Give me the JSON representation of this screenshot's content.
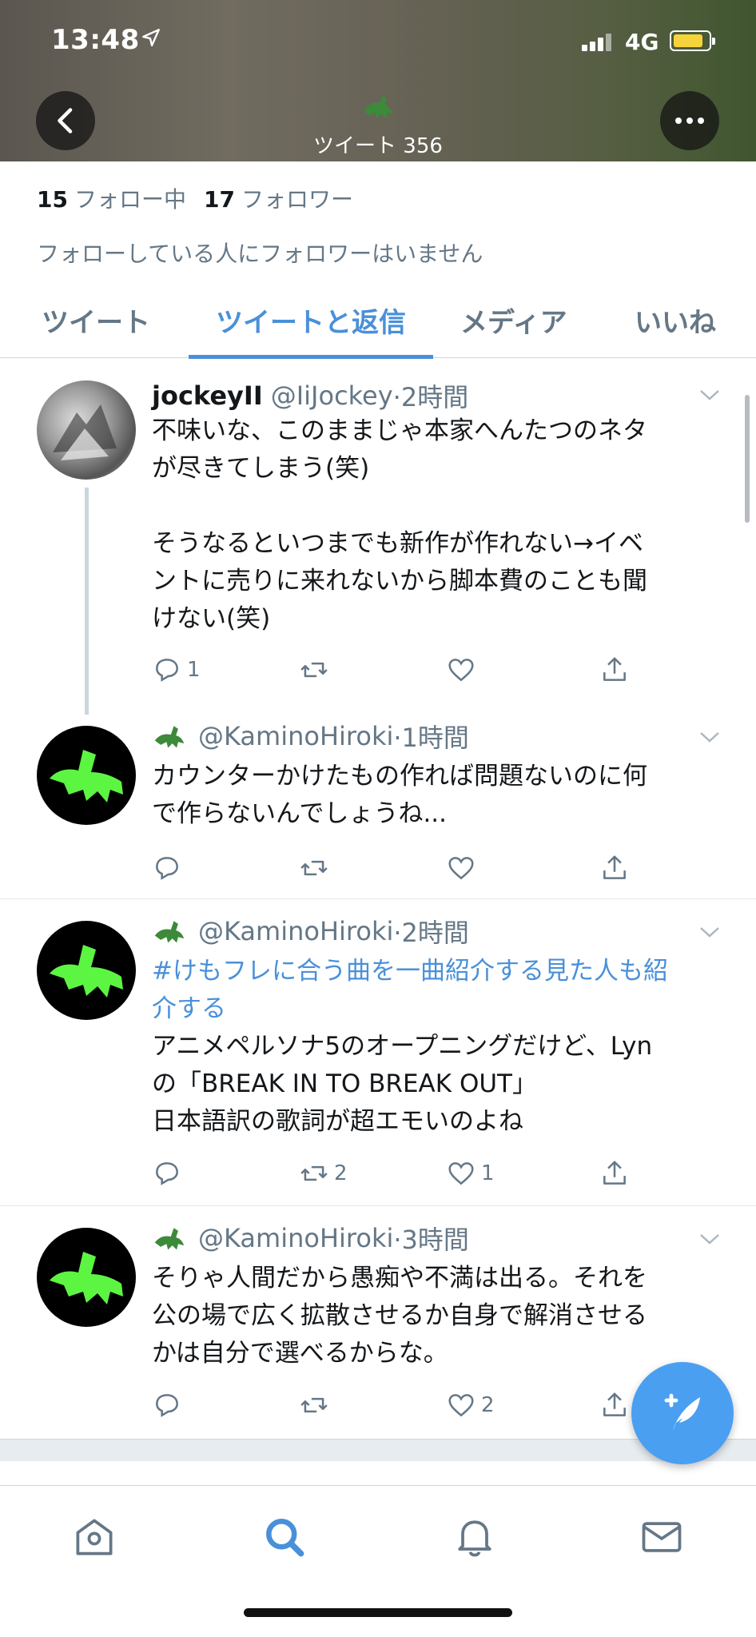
{
  "status_bar": {
    "time": "13:48",
    "network": "4G"
  },
  "header": {
    "tweet_count": "ツイート 356"
  },
  "profile": {
    "following_count": "15",
    "following_label": "フォロー中",
    "followers_count": "17",
    "followers_label": "フォロワー",
    "followers_note": "フォローしている人にフォロワーはいません"
  },
  "tabs": [
    {
      "label": "ツイート"
    },
    {
      "label": "ツイートと返信"
    },
    {
      "label": "メディア"
    },
    {
      "label": "いいね"
    }
  ],
  "tweets": [
    {
      "name": "jockeyII",
      "handle": "@IiJockey",
      "time": "·2時間",
      "text": "不味いな、このままじゃ本家へんたつのネタ\nが尽きてしまう(笑)\n\nそうなるといつまでも新作が作れない→イベ\nントに売りに来れないから脚本費のことも聞\nけない(笑)",
      "replies": "1",
      "retweets": "",
      "likes": ""
    },
    {
      "handle": "@KaminoHiroki",
      "time": "·1時間",
      "text": "カウンターかけたもの作れば問題ないのに何\nで作らないんでしょうね...",
      "replies": "",
      "retweets": "",
      "likes": ""
    },
    {
      "handle": "@KaminoHiroki",
      "time": "·2時間",
      "hashtag": "#けもフレに合う曲を一曲紹介する見た人も紹\n介する",
      "text": "アニメペルソナ5のオープニングだけど、Lyn\nの「BREAK IN TO BREAK OUT」\n日本語訳の歌詞が超エモいのよね",
      "replies": "",
      "retweets": "2",
      "likes": "1"
    },
    {
      "handle": "@KaminoHiroki",
      "time": "·3時間",
      "text": "そりゃ人間だから愚痴や不満は出る。それを\n公の場で広く拡散させるか自身で解消させる\nかは自分で選べるからな。",
      "replies": "",
      "retweets": "",
      "likes": "2"
    }
  ],
  "colors": {
    "accent": "#4a90d9",
    "croc_green": "#5cf542",
    "muted": "#657786"
  },
  "icons": [
    "back-icon",
    "more-icon",
    "reply-icon",
    "retweet-icon",
    "like-icon",
    "share-icon",
    "compose-icon",
    "home-icon",
    "search-icon",
    "notifications-icon",
    "messages-icon"
  ]
}
